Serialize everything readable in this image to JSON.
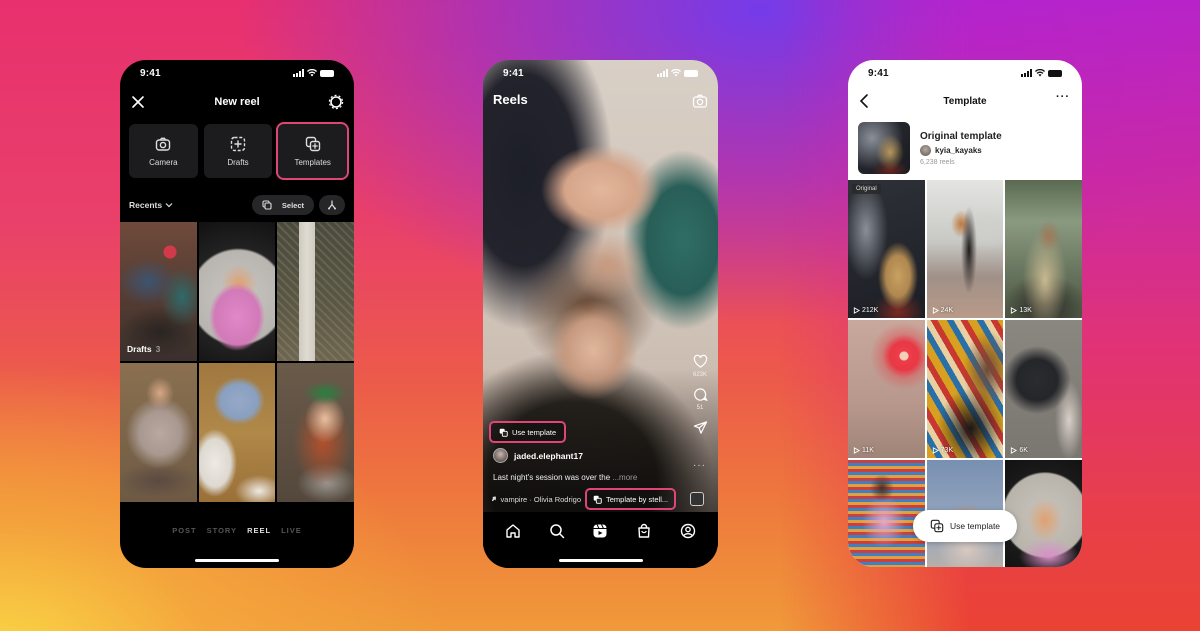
{
  "theme": {
    "accent_highlight": "#e0457a",
    "background_top_left": "#e8306e",
    "background_top_center": "#6e3cf0",
    "background_top_right": "#b522d0",
    "background_bottom_left": "#f8d446",
    "background_bottom_right": "#ea3a34"
  },
  "phone1": {
    "status": {
      "time": "9:41"
    },
    "header": {
      "title": "New reel",
      "close_icon": "close-icon",
      "settings_icon": "gear-icon"
    },
    "tiles": [
      {
        "label": "Camera",
        "icon": "camera-icon",
        "selected": false
      },
      {
        "label": "Drafts",
        "icon": "drafts-icon",
        "selected": false
      },
      {
        "label": "Templates",
        "icon": "templates-icon",
        "selected": true
      }
    ],
    "recents": {
      "label": "Recents",
      "select_label": "Select"
    },
    "grid": {
      "drafts_label": "Drafts",
      "drafts_count": "3"
    },
    "modes": [
      {
        "label": "POST",
        "active": false
      },
      {
        "label": "STORY",
        "active": false
      },
      {
        "label": "REEL",
        "active": true
      },
      {
        "label": "LIVE",
        "active": false
      }
    ]
  },
  "phone2": {
    "status": {
      "time": "9:41"
    },
    "header": {
      "title": "Reels",
      "camera_icon": "camera-icon"
    },
    "actions": {
      "likes": "623K",
      "comments": "51"
    },
    "use_template_label": "Use template",
    "username": "jaded.elephant17",
    "caption": "Last night's session was over the",
    "caption_more": "...more",
    "music": "vampire · Olivia Rodrigo",
    "template_by": "Template by stell...",
    "nav": [
      "home-icon",
      "search-icon",
      "reels-icon",
      "shop-icon",
      "profile-icon"
    ]
  },
  "phone3": {
    "status": {
      "time": "9:41"
    },
    "header": {
      "title": "Template",
      "back_icon": "chevron-left-icon",
      "more_icon": "more-icon"
    },
    "original": {
      "title": "Original template",
      "username": "kyia_kayaks",
      "reel_count": "6,238 reels"
    },
    "grid": [
      {
        "views": "212K",
        "badge": "Original"
      },
      {
        "views": "24K"
      },
      {
        "views": "13K"
      },
      {
        "views": "11K"
      },
      {
        "views": "73K"
      },
      {
        "views": "6K"
      },
      {},
      {},
      {}
    ],
    "use_template_label": "Use template"
  }
}
